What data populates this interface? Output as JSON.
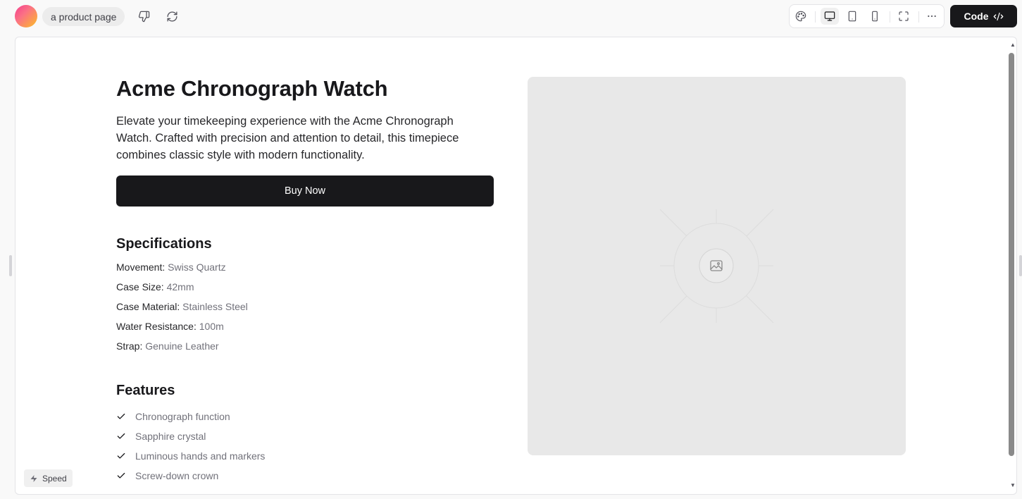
{
  "header": {
    "prompt": "a product page",
    "code_label": "Code"
  },
  "toolbar": {
    "icons": [
      "palette-icon",
      "desktop-icon",
      "tablet-icon",
      "phone-icon",
      "fullscreen-icon",
      "more-icon"
    ],
    "active_view": "desktop"
  },
  "product": {
    "title": "Acme Chronograph Watch",
    "description": "Elevate your timekeeping experience with the Acme Chronograph Watch. Crafted with precision and attention to detail, this timepiece combines classic style with modern functionality.",
    "buy_label": "Buy Now"
  },
  "specs": {
    "heading": "Specifications",
    "items": [
      {
        "label": "Movement:",
        "value": "Swiss Quartz"
      },
      {
        "label": "Case Size:",
        "value": "42mm"
      },
      {
        "label": "Case Material:",
        "value": "Stainless Steel"
      },
      {
        "label": "Water Resistance:",
        "value": "100m"
      },
      {
        "label": "Strap:",
        "value": "Genuine Leather"
      }
    ]
  },
  "features": {
    "heading": "Features",
    "items": [
      "Chronograph function",
      "Sapphire crystal",
      "Luminous hands and markers",
      "Screw-down crown"
    ]
  },
  "badge": {
    "speed_label": "Speed"
  },
  "colors": {
    "primary": "#18181b",
    "muted": "#71717a",
    "placeholder_bg": "#e8e8e8"
  }
}
